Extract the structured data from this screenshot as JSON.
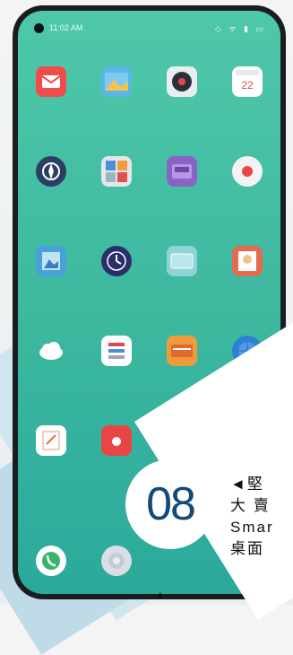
{
  "status_bar": {
    "time": "11:02 AM",
    "icons": "◇ ᯤ ▮ ▭"
  },
  "apps": [
    {
      "name": "mail-app-icon",
      "bg": "#f04c4c"
    },
    {
      "name": "gallery-app-icon",
      "bg": "#5bb6e8"
    },
    {
      "name": "music-app-icon",
      "bg": "#e8eef0"
    },
    {
      "name": "calendar-app-icon",
      "bg": "#ffffff",
      "label": "22"
    },
    {
      "name": "compass-app-icon",
      "bg": "#2c3e64"
    },
    {
      "name": "tools-app-icon",
      "bg": "#e4e7ea"
    },
    {
      "name": "radio-app-icon",
      "bg": "#8a63c7"
    },
    {
      "name": "record-app-icon",
      "bg": "#f3f3f3"
    },
    {
      "name": "photo-app-icon",
      "bg": "#4aa0d8"
    },
    {
      "name": "clock-app-icon",
      "bg": "#2a2f6b"
    },
    {
      "name": "folder-app-icon",
      "bg": "#8fd3d8"
    },
    {
      "name": "contact-card-app-icon",
      "bg": "#e56b50"
    },
    {
      "name": "weather-app-icon",
      "bg": "#ffffff"
    },
    {
      "name": "notes-list-app-icon",
      "bg": "#ffffff"
    },
    {
      "name": "wallet-app-icon",
      "bg": "#f09a3b"
    },
    {
      "name": "globe-app-icon",
      "bg": "#2e7fd6"
    },
    {
      "name": "memo-app-icon",
      "bg": "#ffffff"
    },
    {
      "name": "camera-app-icon",
      "bg": "#e94545"
    },
    {
      "name": "files-app-icon",
      "bg": "#e8efe8"
    },
    {
      "name": "browser-app-icon",
      "bg": "#9acb57"
    }
  ],
  "dock": [
    {
      "name": "phone-app-icon",
      "bg": "#ffffff"
    },
    {
      "name": "settings-app-icon",
      "bg": "#d9dfe4"
    }
  ],
  "caption": {
    "line1": "◄堅",
    "line2": "大 賣",
    "line3": "Smar",
    "line4": "桌面"
  },
  "badge": {
    "number": "08"
  },
  "pointer": "▲"
}
